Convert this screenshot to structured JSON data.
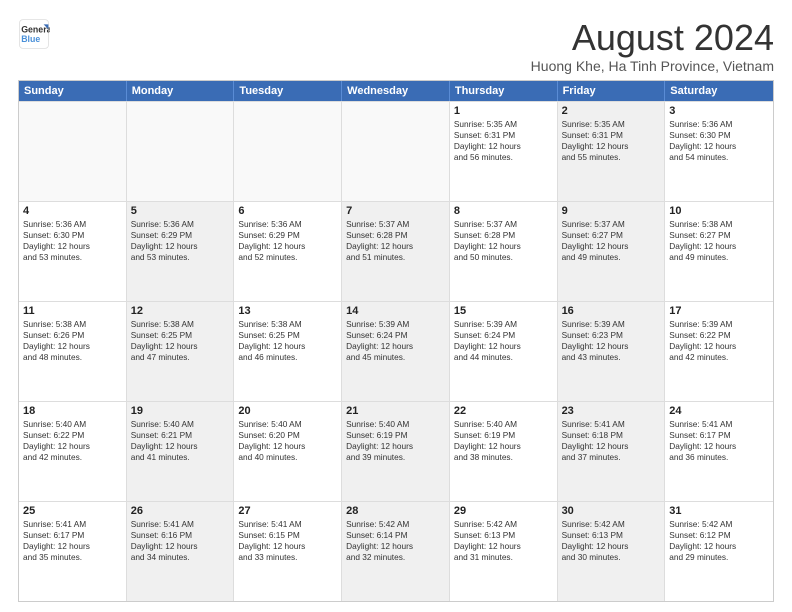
{
  "logo": {
    "line1": "General",
    "line2": "Blue"
  },
  "title": "August 2024",
  "subtitle": "Huong Khe, Ha Tinh Province, Vietnam",
  "header_days": [
    "Sunday",
    "Monday",
    "Tuesday",
    "Wednesday",
    "Thursday",
    "Friday",
    "Saturday"
  ],
  "rows": [
    [
      {
        "day": "",
        "info": "",
        "shaded": false,
        "empty": true
      },
      {
        "day": "",
        "info": "",
        "shaded": false,
        "empty": true
      },
      {
        "day": "",
        "info": "",
        "shaded": false,
        "empty": true
      },
      {
        "day": "",
        "info": "",
        "shaded": false,
        "empty": true
      },
      {
        "day": "1",
        "info": "Sunrise: 5:35 AM\nSunset: 6:31 PM\nDaylight: 12 hours\nand 56 minutes.",
        "shaded": false,
        "empty": false
      },
      {
        "day": "2",
        "info": "Sunrise: 5:35 AM\nSunset: 6:31 PM\nDaylight: 12 hours\nand 55 minutes.",
        "shaded": true,
        "empty": false
      },
      {
        "day": "3",
        "info": "Sunrise: 5:36 AM\nSunset: 6:30 PM\nDaylight: 12 hours\nand 54 minutes.",
        "shaded": false,
        "empty": false
      }
    ],
    [
      {
        "day": "4",
        "info": "Sunrise: 5:36 AM\nSunset: 6:30 PM\nDaylight: 12 hours\nand 53 minutes.",
        "shaded": false,
        "empty": false
      },
      {
        "day": "5",
        "info": "Sunrise: 5:36 AM\nSunset: 6:29 PM\nDaylight: 12 hours\nand 53 minutes.",
        "shaded": true,
        "empty": false
      },
      {
        "day": "6",
        "info": "Sunrise: 5:36 AM\nSunset: 6:29 PM\nDaylight: 12 hours\nand 52 minutes.",
        "shaded": false,
        "empty": false
      },
      {
        "day": "7",
        "info": "Sunrise: 5:37 AM\nSunset: 6:28 PM\nDaylight: 12 hours\nand 51 minutes.",
        "shaded": true,
        "empty": false
      },
      {
        "day": "8",
        "info": "Sunrise: 5:37 AM\nSunset: 6:28 PM\nDaylight: 12 hours\nand 50 minutes.",
        "shaded": false,
        "empty": false
      },
      {
        "day": "9",
        "info": "Sunrise: 5:37 AM\nSunset: 6:27 PM\nDaylight: 12 hours\nand 49 minutes.",
        "shaded": true,
        "empty": false
      },
      {
        "day": "10",
        "info": "Sunrise: 5:38 AM\nSunset: 6:27 PM\nDaylight: 12 hours\nand 49 minutes.",
        "shaded": false,
        "empty": false
      }
    ],
    [
      {
        "day": "11",
        "info": "Sunrise: 5:38 AM\nSunset: 6:26 PM\nDaylight: 12 hours\nand 48 minutes.",
        "shaded": false,
        "empty": false
      },
      {
        "day": "12",
        "info": "Sunrise: 5:38 AM\nSunset: 6:25 PM\nDaylight: 12 hours\nand 47 minutes.",
        "shaded": true,
        "empty": false
      },
      {
        "day": "13",
        "info": "Sunrise: 5:38 AM\nSunset: 6:25 PM\nDaylight: 12 hours\nand 46 minutes.",
        "shaded": false,
        "empty": false
      },
      {
        "day": "14",
        "info": "Sunrise: 5:39 AM\nSunset: 6:24 PM\nDaylight: 12 hours\nand 45 minutes.",
        "shaded": true,
        "empty": false
      },
      {
        "day": "15",
        "info": "Sunrise: 5:39 AM\nSunset: 6:24 PM\nDaylight: 12 hours\nand 44 minutes.",
        "shaded": false,
        "empty": false
      },
      {
        "day": "16",
        "info": "Sunrise: 5:39 AM\nSunset: 6:23 PM\nDaylight: 12 hours\nand 43 minutes.",
        "shaded": true,
        "empty": false
      },
      {
        "day": "17",
        "info": "Sunrise: 5:39 AM\nSunset: 6:22 PM\nDaylight: 12 hours\nand 42 minutes.",
        "shaded": false,
        "empty": false
      }
    ],
    [
      {
        "day": "18",
        "info": "Sunrise: 5:40 AM\nSunset: 6:22 PM\nDaylight: 12 hours\nand 42 minutes.",
        "shaded": false,
        "empty": false
      },
      {
        "day": "19",
        "info": "Sunrise: 5:40 AM\nSunset: 6:21 PM\nDaylight: 12 hours\nand 41 minutes.",
        "shaded": true,
        "empty": false
      },
      {
        "day": "20",
        "info": "Sunrise: 5:40 AM\nSunset: 6:20 PM\nDaylight: 12 hours\nand 40 minutes.",
        "shaded": false,
        "empty": false
      },
      {
        "day": "21",
        "info": "Sunrise: 5:40 AM\nSunset: 6:19 PM\nDaylight: 12 hours\nand 39 minutes.",
        "shaded": true,
        "empty": false
      },
      {
        "day": "22",
        "info": "Sunrise: 5:40 AM\nSunset: 6:19 PM\nDaylight: 12 hours\nand 38 minutes.",
        "shaded": false,
        "empty": false
      },
      {
        "day": "23",
        "info": "Sunrise: 5:41 AM\nSunset: 6:18 PM\nDaylight: 12 hours\nand 37 minutes.",
        "shaded": true,
        "empty": false
      },
      {
        "day": "24",
        "info": "Sunrise: 5:41 AM\nSunset: 6:17 PM\nDaylight: 12 hours\nand 36 minutes.",
        "shaded": false,
        "empty": false
      }
    ],
    [
      {
        "day": "25",
        "info": "Sunrise: 5:41 AM\nSunset: 6:17 PM\nDaylight: 12 hours\nand 35 minutes.",
        "shaded": false,
        "empty": false
      },
      {
        "day": "26",
        "info": "Sunrise: 5:41 AM\nSunset: 6:16 PM\nDaylight: 12 hours\nand 34 minutes.",
        "shaded": true,
        "empty": false
      },
      {
        "day": "27",
        "info": "Sunrise: 5:41 AM\nSunset: 6:15 PM\nDaylight: 12 hours\nand 33 minutes.",
        "shaded": false,
        "empty": false
      },
      {
        "day": "28",
        "info": "Sunrise: 5:42 AM\nSunset: 6:14 PM\nDaylight: 12 hours\nand 32 minutes.",
        "shaded": true,
        "empty": false
      },
      {
        "day": "29",
        "info": "Sunrise: 5:42 AM\nSunset: 6:13 PM\nDaylight: 12 hours\nand 31 minutes.",
        "shaded": false,
        "empty": false
      },
      {
        "day": "30",
        "info": "Sunrise: 5:42 AM\nSunset: 6:13 PM\nDaylight: 12 hours\nand 30 minutes.",
        "shaded": true,
        "empty": false
      },
      {
        "day": "31",
        "info": "Sunrise: 5:42 AM\nSunset: 6:12 PM\nDaylight: 12 hours\nand 29 minutes.",
        "shaded": false,
        "empty": false
      }
    ]
  ]
}
